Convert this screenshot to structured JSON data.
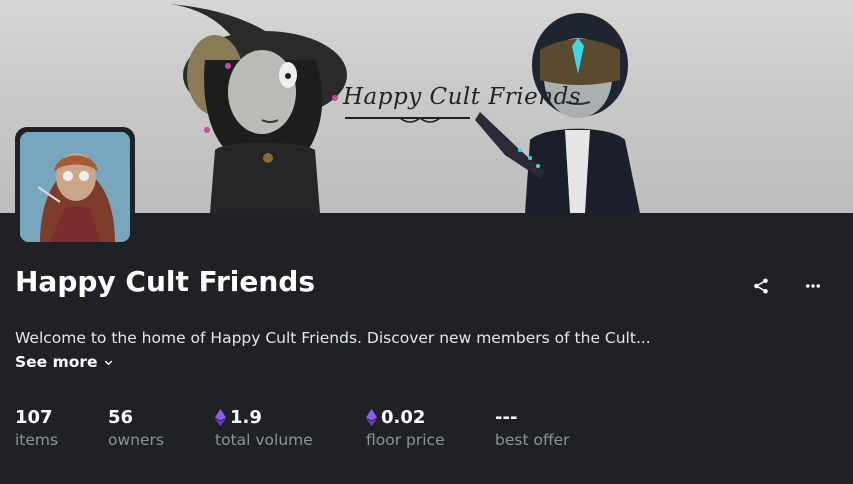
{
  "banner": {
    "title": "Happy Cult Friends"
  },
  "collection": {
    "name": "Happy Cult Friends",
    "description": "Welcome to the home of Happy Cult Friends. Discover new members of the Cult...",
    "see_more_label": "See more"
  },
  "actions": {
    "share_icon": "share-icon",
    "more_icon": "more-horizontal-icon"
  },
  "stats": [
    {
      "value": "107",
      "label": "items"
    },
    {
      "value": "56",
      "label": "owners"
    },
    {
      "value": "1.9",
      "label": "total volume",
      "currency_icon": "eth-icon"
    },
    {
      "value": "0.02",
      "label": "floor price",
      "currency_icon": "eth-icon"
    },
    {
      "value": "---",
      "label": "best offer"
    }
  ],
  "colors": {
    "background": "#202125",
    "muted_text": "#8a939b",
    "eth": "#8b5cf6"
  }
}
